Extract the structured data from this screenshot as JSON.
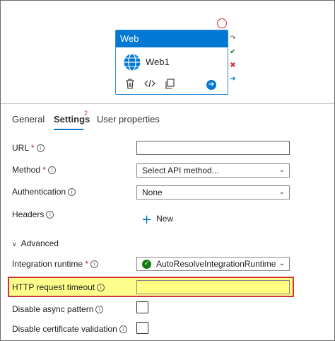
{
  "activity": {
    "type_label": "Web",
    "name": "Web1"
  },
  "tabs": [
    {
      "label": "General"
    },
    {
      "label": "Settings",
      "badge": "2"
    },
    {
      "label": "User properties"
    }
  ],
  "form": {
    "url": {
      "label": "URL",
      "required": "*",
      "value": ""
    },
    "method": {
      "label": "Method",
      "required": "*",
      "value": "Select API method..."
    },
    "authentication": {
      "label": "Authentication",
      "value": "None"
    },
    "headers": {
      "label": "Headers",
      "new_label": "New"
    },
    "advanced_label": "Advanced",
    "integration_runtime": {
      "label": "Integration runtime",
      "required": "*",
      "value": "AutoResolveIntegrationRuntime"
    },
    "http_timeout": {
      "label": "HTTP request timeout",
      "value": ""
    },
    "disable_async": {
      "label": "Disable async pattern",
      "checked": false
    },
    "disable_cert": {
      "label": "Disable certificate validation",
      "checked": false
    }
  },
  "colors": {
    "accent": "#0078d4",
    "highlight_fill": "#fdfd8c",
    "highlight_border": "#d13438",
    "success": "#107c10"
  }
}
